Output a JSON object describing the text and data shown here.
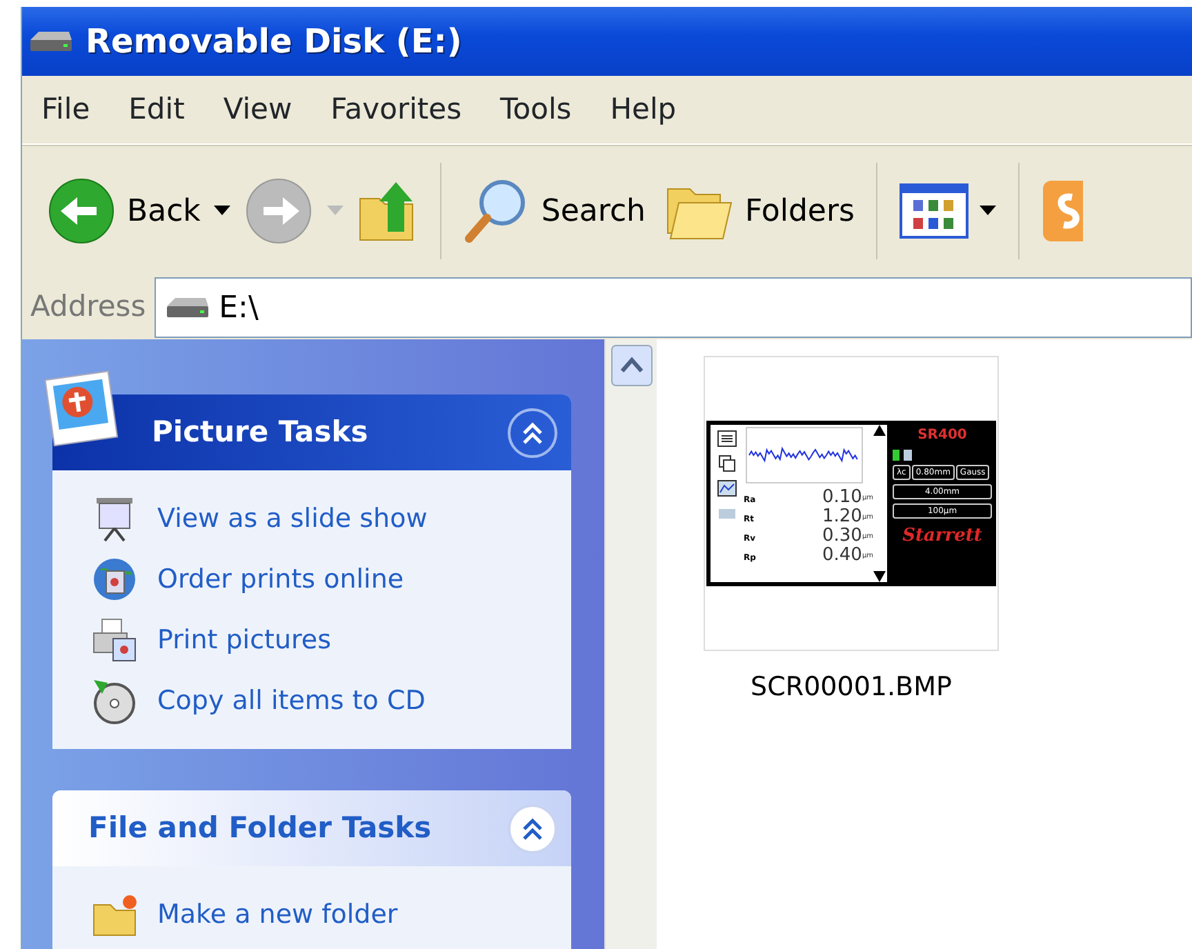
{
  "window": {
    "title": "Removable Disk (E:)"
  },
  "menu": [
    "File",
    "Edit",
    "View",
    "Favorites",
    "Tools",
    "Help"
  ],
  "toolbar": [
    {
      "kind": "back",
      "label": "Back",
      "disabled": false
    },
    {
      "kind": "forward",
      "disabled": true
    },
    {
      "kind": "up"
    },
    {
      "kind": "search",
      "label": "Search"
    },
    {
      "kind": "folders",
      "label": "Folders"
    },
    {
      "kind": "views"
    },
    {
      "kind": "app"
    }
  ],
  "address": {
    "label": "Address",
    "value": "E:\\"
  },
  "sidebar": [
    {
      "title": "Picture Tasks",
      "kind": "special",
      "expanded": true,
      "items": [
        {
          "label": "View as a slide show"
        },
        {
          "label": "Order prints online"
        },
        {
          "label": "Print pictures"
        },
        {
          "label": "Copy all items to CD"
        }
      ]
    },
    {
      "title": "File and Folder Tasks",
      "kind": "normal",
      "expanded": true,
      "items": [
        {
          "label": "Make a new folder"
        }
      ]
    }
  ],
  "files": [
    {
      "name": "SCR00001.BMP",
      "selected": false,
      "thumbnail": {
        "model": "SR400",
        "brand": "Starrett",
        "cutoff_symbol": "λc",
        "cutoff": "0.80mm",
        "filter": "Gauss",
        "length": "4.00mm",
        "range": "100µm",
        "readings": [
          {
            "param": "Ra",
            "value": "0.10",
            "unit": "µm"
          },
          {
            "param": "Rt",
            "value": "1.20",
            "unit": "µm"
          },
          {
            "param": "Rv",
            "value": "0.30",
            "unit": "µm"
          },
          {
            "param": "Rp",
            "value": "0.40",
            "unit": "µm"
          }
        ]
      }
    }
  ]
}
